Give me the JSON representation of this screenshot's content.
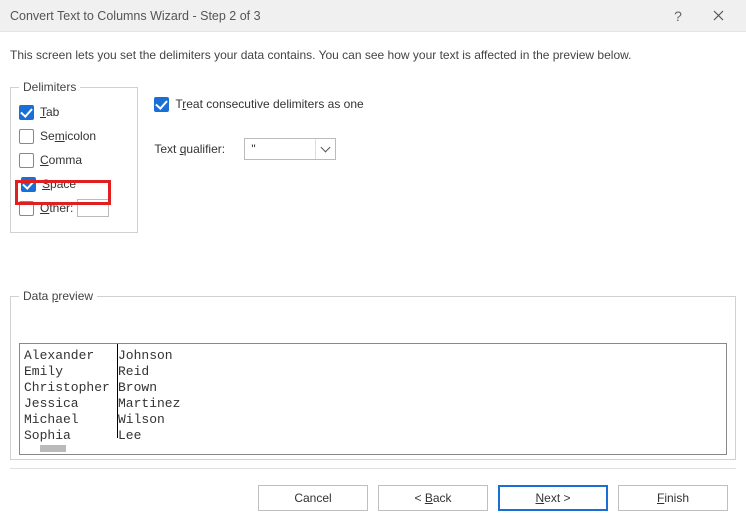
{
  "title": "Convert Text to Columns Wizard - Step 2 of 3",
  "intro": "This screen lets you set the delimiters your data contains.  You can see how your text is affected in the preview below.",
  "delimiters": {
    "legend": "Delimiters",
    "tab": {
      "label_pre": "T",
      "label_post": "ab",
      "checked": true
    },
    "semicolon": {
      "label_pre": "Se",
      "label_u": "m",
      "label_post": "icolon",
      "checked": false
    },
    "comma": {
      "label_pre": "",
      "label_u": "C",
      "label_post": "omma",
      "checked": false
    },
    "space": {
      "label_pre": "",
      "label_u": "S",
      "label_post": "pace",
      "checked": true
    },
    "other": {
      "label_pre": "",
      "label_u": "O",
      "label_post": "ther:",
      "checked": false,
      "value": ""
    }
  },
  "options": {
    "consecutive": {
      "label_pre": "T",
      "label_u": "r",
      "label_post": "eat consecutive delimiters as one",
      "checked": true
    },
    "qualifier_label_pre": "Text ",
    "qualifier_label_u": "q",
    "qualifier_label_post": "ualifier:",
    "qualifier_value": "\""
  },
  "preview": {
    "legend_pre": "Data ",
    "legend_u": "p",
    "legend_post": "review",
    "rows": [
      {
        "c1": "Alexander",
        "c2": "Johnson"
      },
      {
        "c1": "Emily",
        "c2": "Reid"
      },
      {
        "c1": "Christopher",
        "c2": "Brown"
      },
      {
        "c1": "Jessica",
        "c2": "Martinez"
      },
      {
        "c1": "Michael",
        "c2": "Wilson"
      },
      {
        "c1": "Sophia",
        "c2": "Lee"
      }
    ]
  },
  "buttons": {
    "cancel": "Cancel",
    "back_pre": "< ",
    "back_u": "B",
    "back_post": "ack",
    "next_pre": "",
    "next_u": "N",
    "next_post": "ext >",
    "finish_pre": "",
    "finish_u": "F",
    "finish_post": "inish"
  },
  "highlight": {
    "target": "space"
  }
}
